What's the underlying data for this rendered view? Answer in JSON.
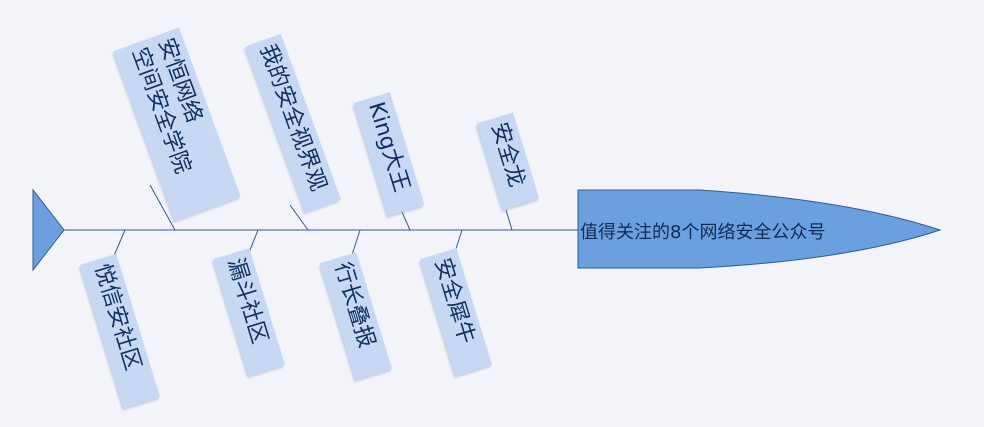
{
  "diagram": {
    "head": {
      "text": "值得关注的8个网络安全公众号"
    },
    "colors": {
      "background": "#f3f4fa",
      "spine": "#2f5a8f",
      "head_fill": "#6aa0e0",
      "head_stroke": "#2f5a8f",
      "label_fill": "#c6d8f4",
      "label_text": "#0f2f5e"
    },
    "top_bones": [
      {
        "lines": [
          "安恒网络",
          "空间安全学院"
        ]
      },
      {
        "lines": [
          "我的安全视界观"
        ]
      },
      {
        "lines": [
          "King大王"
        ]
      },
      {
        "lines": [
          "安全龙"
        ]
      }
    ],
    "bottom_bones": [
      {
        "lines": [
          "悦信安社区"
        ]
      },
      {
        "lines": [
          "漏斗社区"
        ]
      },
      {
        "lines": [
          "行长叠报"
        ]
      },
      {
        "lines": [
          "安全犀牛"
        ]
      }
    ]
  }
}
